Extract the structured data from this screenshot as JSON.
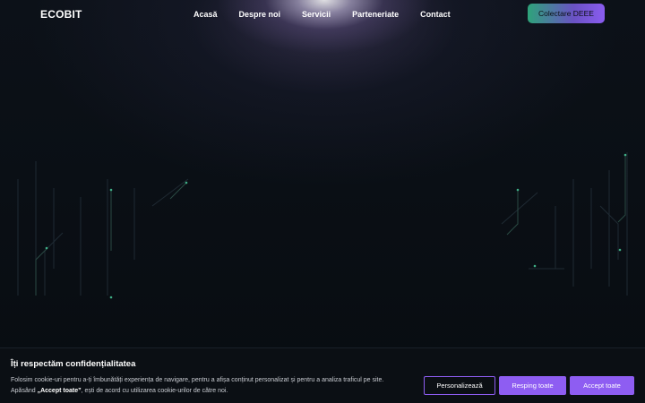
{
  "header": {
    "logo": "ECOBIT",
    "nav": [
      {
        "label": "Acasă"
      },
      {
        "label": "Despre noi"
      },
      {
        "label": "Servicii"
      },
      {
        "label": "Parteneriate"
      },
      {
        "label": "Contact"
      }
    ],
    "cta_label": "Colectare DEEE"
  },
  "cookie_banner": {
    "title": "Îți respectăm confidențialitatea",
    "text_line1": "Folosim cookie-uri pentru a-ți îmbunătăți experiența de navigare, pentru a afișa conținut personalizat și pentru a analiza traficul pe site.",
    "text_line2_prefix": "Apăsând ",
    "text_line2_bold": "„Accept toate”",
    "text_line2_suffix": ", ești de acord cu utilizarea cookie-urilor de către noi.",
    "customize_label": "Personalizează",
    "reject_label": "Resping toate",
    "accept_label": "Accept toate"
  },
  "colors": {
    "background": "#070b10",
    "accent_purple": "#8e5df2",
    "accent_green": "#2ea37a",
    "circuit_green": "#3fae86"
  },
  "icons": {
    "decoration": "circuit-board-pattern"
  }
}
